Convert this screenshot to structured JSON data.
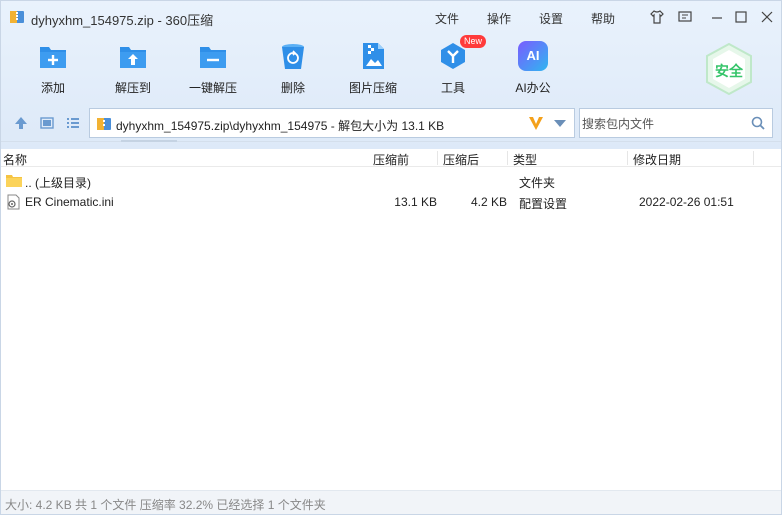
{
  "window": {
    "title": "dyhyxhm_154975.zip - 360压缩"
  },
  "menu": [
    "文件",
    "操作",
    "设置",
    "帮助"
  ],
  "toolbar": {
    "add": "添加",
    "extract_to": "解压到",
    "one_click_extract": "一键解压",
    "delete": "删除",
    "image_compress": "图片压缩",
    "tools": "工具",
    "tools_badge": "New",
    "ai_office": "AI办公",
    "ai_icon_text": "AI",
    "safe_badge": "安全"
  },
  "address": {
    "path": "dyhyxhm_154975.zip\\dyhyxhm_154975 - 解包大小为 13.1 KB",
    "search_placeholder": "搜索包内文件"
  },
  "columns": {
    "name": "名称",
    "compressed_before": "压缩前",
    "compressed_after": "压缩后",
    "type": "类型",
    "modified": "修改日期"
  },
  "rows": [
    {
      "name": ".. (上级目录)",
      "before": "",
      "after": "",
      "type": "文件夹",
      "modified": ""
    },
    {
      "name": "ER Cinematic.ini",
      "before": "13.1 KB",
      "after": "4.2 KB",
      "type": "配置设置",
      "modified": "2022-02-26 01:51"
    }
  ],
  "status": {
    "text": "大小: 4.2 KB 共 1 个文件 压缩率 32.2% 已经选择 1 个文件夹"
  },
  "colors": {
    "accent": "#2f8fe8",
    "safe_green": "#35c46a",
    "badge_red": "#ff3b3b"
  }
}
